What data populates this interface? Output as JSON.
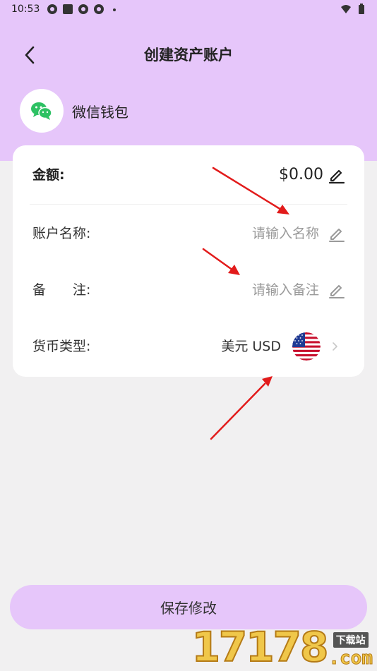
{
  "status_bar": {
    "time": "10:53"
  },
  "header": {
    "title": "创建资产账户"
  },
  "wallet": {
    "name": "微信钱包",
    "icon": "wechat-icon",
    "color": "#2dc163"
  },
  "form": {
    "amount_label": "金额:",
    "amount_value": "$0.00",
    "account_name_label": "账户名称:",
    "account_name_placeholder": "请输入名称",
    "note_label": "备　　注:",
    "note_placeholder": "请输入备注",
    "currency_label": "货币类型:",
    "currency_value": "美元 USD",
    "currency_flag": "us-flag-icon"
  },
  "save_button": {
    "label": "保存修改"
  },
  "watermark": {
    "number": "17178",
    "top": "下载站",
    "domain": ".com"
  },
  "colors": {
    "accent": "#e6c6fa",
    "background": "#f1f0f1",
    "annotation_arrow": "#e21b1b"
  }
}
